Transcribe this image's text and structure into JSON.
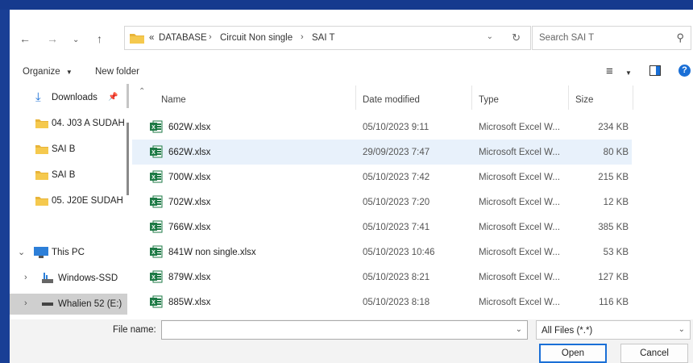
{
  "address": {
    "overflow": "«",
    "crumbs": [
      "DATABASE",
      "Circuit Non single",
      "SAI T"
    ]
  },
  "search": {
    "placeholder": "Search SAI T"
  },
  "toolbar": {
    "organize": "Organize",
    "new_folder": "New folder"
  },
  "nav": {
    "items": [
      {
        "label": "Downloads",
        "icon": "download-icon"
      },
      {
        "label": "04. J03 A SUDAH",
        "icon": "folder-icon"
      },
      {
        "label": "SAI B",
        "icon": "folder-icon"
      },
      {
        "label": "SAI B",
        "icon": "folder-icon"
      },
      {
        "label": "05. J20E SUDAH",
        "icon": "folder-icon"
      },
      {
        "label": "This PC",
        "icon": "monitor-icon"
      },
      {
        "label": "Windows-SSD",
        "icon": "drive-icon"
      },
      {
        "label": "Whalien 52 (E:)",
        "icon": "usb-drive-icon"
      }
    ]
  },
  "columns": {
    "name": "Name",
    "date": "Date modified",
    "type": "Type",
    "size": "Size"
  },
  "files": [
    {
      "name": "602W.xlsx",
      "date": "05/10/2023 9:11",
      "type": "Microsoft Excel W...",
      "size": "234 KB"
    },
    {
      "name": "662W.xlsx",
      "date": "29/09/2023 7:47",
      "type": "Microsoft Excel W...",
      "size": "80 KB"
    },
    {
      "name": "700W.xlsx",
      "date": "05/10/2023 7:42",
      "type": "Microsoft Excel W...",
      "size": "215 KB"
    },
    {
      "name": "702W.xlsx",
      "date": "05/10/2023 7:20",
      "type": "Microsoft Excel W...",
      "size": "12 KB"
    },
    {
      "name": "766W.xlsx",
      "date": "05/10/2023 7:41",
      "type": "Microsoft Excel W...",
      "size": "385 KB"
    },
    {
      "name": "841W non single.xlsx",
      "date": "05/10/2023 10:46",
      "type": "Microsoft Excel W...",
      "size": "53 KB"
    },
    {
      "name": "879W.xlsx",
      "date": "05/10/2023 8:21",
      "type": "Microsoft Excel W...",
      "size": "127 KB"
    },
    {
      "name": "885W.xlsx",
      "date": "05/10/2023 8:18",
      "type": "Microsoft Excel W...",
      "size": "116 KB"
    }
  ],
  "footer": {
    "file_name_label": "File name:",
    "file_name_value": "",
    "filter": "All Files (*.*)",
    "open": "Open",
    "cancel": "Cancel"
  },
  "colors": {
    "accent": "#1a6fd6",
    "excel": "#1d7a45",
    "folder": "#e8b43a",
    "desktop_bg": "#1d3f8c"
  }
}
